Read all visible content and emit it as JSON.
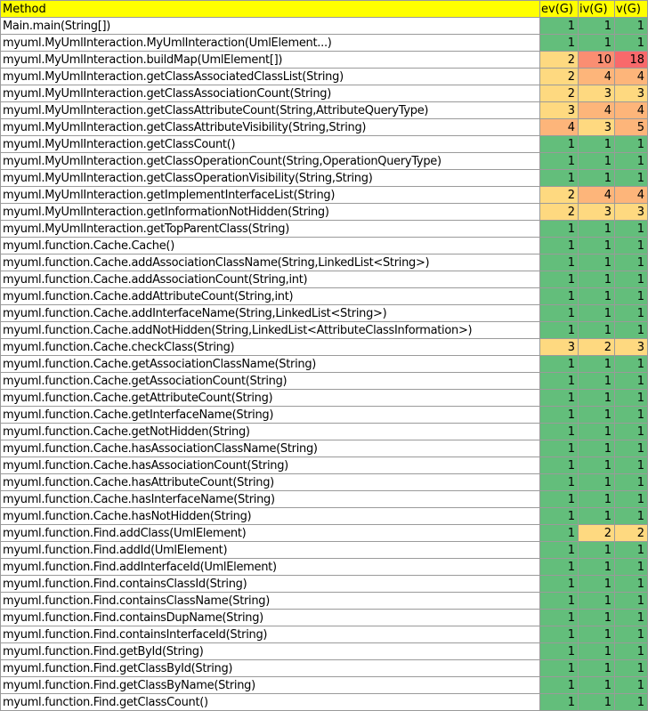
{
  "headers": [
    "Method",
    "ev(G)",
    "iv(G)",
    "v(G)"
  ],
  "colors": {
    "header": "#ffff00",
    "green": "#63be7b",
    "light_orange": "#fed980",
    "orange": "#fdb57a",
    "red": "#f8696b",
    "salmon": "#fa8e72",
    "grid": "#9a9a9a"
  },
  "rows": [
    {
      "method": "Main.main(String[])",
      "ev": "1",
      "iv": "1",
      "v": "1",
      "ev_color": "green",
      "iv_color": "green",
      "v_color": "green"
    },
    {
      "method": "myuml.MyUmlInteraction.MyUmlInteraction(UmlElement...)",
      "ev": "1",
      "iv": "1",
      "v": "1",
      "ev_color": "green",
      "iv_color": "green",
      "v_color": "green"
    },
    {
      "method": "myuml.MyUmlInteraction.buildMap(UmlElement[])",
      "ev": "2",
      "iv": "10",
      "v": "18",
      "ev_color": "light_orange",
      "iv_color": "salmon",
      "v_color": "red"
    },
    {
      "method": "myuml.MyUmlInteraction.getClassAssociatedClassList(String)",
      "ev": "2",
      "iv": "4",
      "v": "4",
      "ev_color": "light_orange",
      "iv_color": "orange",
      "v_color": "orange"
    },
    {
      "method": "myuml.MyUmlInteraction.getClassAssociationCount(String)",
      "ev": "2",
      "iv": "3",
      "v": "3",
      "ev_color": "light_orange",
      "iv_color": "light_orange",
      "v_color": "light_orange"
    },
    {
      "method": "myuml.MyUmlInteraction.getClassAttributeCount(String,AttributeQueryType)",
      "ev": "3",
      "iv": "4",
      "v": "4",
      "ev_color": "light_orange",
      "iv_color": "orange",
      "v_color": "orange"
    },
    {
      "method": "myuml.MyUmlInteraction.getClassAttributeVisibility(String,String)",
      "ev": "4",
      "iv": "3",
      "v": "5",
      "ev_color": "orange",
      "iv_color": "light_orange",
      "v_color": "orange"
    },
    {
      "method": "myuml.MyUmlInteraction.getClassCount()",
      "ev": "1",
      "iv": "1",
      "v": "1",
      "ev_color": "green",
      "iv_color": "green",
      "v_color": "green"
    },
    {
      "method": "myuml.MyUmlInteraction.getClassOperationCount(String,OperationQueryType)",
      "ev": "1",
      "iv": "1",
      "v": "1",
      "ev_color": "green",
      "iv_color": "green",
      "v_color": "green"
    },
    {
      "method": "myuml.MyUmlInteraction.getClassOperationVisibility(String,String)",
      "ev": "1",
      "iv": "1",
      "v": "1",
      "ev_color": "green",
      "iv_color": "green",
      "v_color": "green"
    },
    {
      "method": "myuml.MyUmlInteraction.getImplementInterfaceList(String)",
      "ev": "2",
      "iv": "4",
      "v": "4",
      "ev_color": "light_orange",
      "iv_color": "orange",
      "v_color": "orange"
    },
    {
      "method": "myuml.MyUmlInteraction.getInformationNotHidden(String)",
      "ev": "2",
      "iv": "3",
      "v": "3",
      "ev_color": "light_orange",
      "iv_color": "light_orange",
      "v_color": "light_orange"
    },
    {
      "method": "myuml.MyUmlInteraction.getTopParentClass(String)",
      "ev": "1",
      "iv": "1",
      "v": "1",
      "ev_color": "green",
      "iv_color": "green",
      "v_color": "green"
    },
    {
      "method": "myuml.function.Cache.Cache()",
      "ev": "1",
      "iv": "1",
      "v": "1",
      "ev_color": "green",
      "iv_color": "green",
      "v_color": "green"
    },
    {
      "method": "myuml.function.Cache.addAssociationClassName(String,LinkedList<String>)",
      "ev": "1",
      "iv": "1",
      "v": "1",
      "ev_color": "green",
      "iv_color": "green",
      "v_color": "green"
    },
    {
      "method": "myuml.function.Cache.addAssociationCount(String,int)",
      "ev": "1",
      "iv": "1",
      "v": "1",
      "ev_color": "green",
      "iv_color": "green",
      "v_color": "green"
    },
    {
      "method": "myuml.function.Cache.addAttributeCount(String,int)",
      "ev": "1",
      "iv": "1",
      "v": "1",
      "ev_color": "green",
      "iv_color": "green",
      "v_color": "green"
    },
    {
      "method": "myuml.function.Cache.addInterfaceName(String,LinkedList<String>)",
      "ev": "1",
      "iv": "1",
      "v": "1",
      "ev_color": "green",
      "iv_color": "green",
      "v_color": "green"
    },
    {
      "method": "myuml.function.Cache.addNotHidden(String,LinkedList<AttributeClassInformation>)",
      "ev": "1",
      "iv": "1",
      "v": "1",
      "ev_color": "green",
      "iv_color": "green",
      "v_color": "green"
    },
    {
      "method": "myuml.function.Cache.checkClass(String)",
      "ev": "3",
      "iv": "2",
      "v": "3",
      "ev_color": "light_orange",
      "iv_color": "light_orange",
      "v_color": "light_orange"
    },
    {
      "method": "myuml.function.Cache.getAssociationClassName(String)",
      "ev": "1",
      "iv": "1",
      "v": "1",
      "ev_color": "green",
      "iv_color": "green",
      "v_color": "green"
    },
    {
      "method": "myuml.function.Cache.getAssociationCount(String)",
      "ev": "1",
      "iv": "1",
      "v": "1",
      "ev_color": "green",
      "iv_color": "green",
      "v_color": "green"
    },
    {
      "method": "myuml.function.Cache.getAttributeCount(String)",
      "ev": "1",
      "iv": "1",
      "v": "1",
      "ev_color": "green",
      "iv_color": "green",
      "v_color": "green"
    },
    {
      "method": "myuml.function.Cache.getInterfaceName(String)",
      "ev": "1",
      "iv": "1",
      "v": "1",
      "ev_color": "green",
      "iv_color": "green",
      "v_color": "green"
    },
    {
      "method": "myuml.function.Cache.getNotHidden(String)",
      "ev": "1",
      "iv": "1",
      "v": "1",
      "ev_color": "green",
      "iv_color": "green",
      "v_color": "green"
    },
    {
      "method": "myuml.function.Cache.hasAssociationClassName(String)",
      "ev": "1",
      "iv": "1",
      "v": "1",
      "ev_color": "green",
      "iv_color": "green",
      "v_color": "green"
    },
    {
      "method": "myuml.function.Cache.hasAssociationCount(String)",
      "ev": "1",
      "iv": "1",
      "v": "1",
      "ev_color": "green",
      "iv_color": "green",
      "v_color": "green"
    },
    {
      "method": "myuml.function.Cache.hasAttributeCount(String)",
      "ev": "1",
      "iv": "1",
      "v": "1",
      "ev_color": "green",
      "iv_color": "green",
      "v_color": "green"
    },
    {
      "method": "myuml.function.Cache.hasInterfaceName(String)",
      "ev": "1",
      "iv": "1",
      "v": "1",
      "ev_color": "green",
      "iv_color": "green",
      "v_color": "green"
    },
    {
      "method": "myuml.function.Cache.hasNotHidden(String)",
      "ev": "1",
      "iv": "1",
      "v": "1",
      "ev_color": "green",
      "iv_color": "green",
      "v_color": "green"
    },
    {
      "method": "myuml.function.Find.addClass(UmlElement)",
      "ev": "1",
      "iv": "2",
      "v": "2",
      "ev_color": "green",
      "iv_color": "light_orange",
      "v_color": "light_orange"
    },
    {
      "method": "myuml.function.Find.addId(UmlElement)",
      "ev": "1",
      "iv": "1",
      "v": "1",
      "ev_color": "green",
      "iv_color": "green",
      "v_color": "green"
    },
    {
      "method": "myuml.function.Find.addInterfaceId(UmlElement)",
      "ev": "1",
      "iv": "1",
      "v": "1",
      "ev_color": "green",
      "iv_color": "green",
      "v_color": "green"
    },
    {
      "method": "myuml.function.Find.containsClassId(String)",
      "ev": "1",
      "iv": "1",
      "v": "1",
      "ev_color": "green",
      "iv_color": "green",
      "v_color": "green"
    },
    {
      "method": "myuml.function.Find.containsClassName(String)",
      "ev": "1",
      "iv": "1",
      "v": "1",
      "ev_color": "green",
      "iv_color": "green",
      "v_color": "green"
    },
    {
      "method": "myuml.function.Find.containsDupName(String)",
      "ev": "1",
      "iv": "1",
      "v": "1",
      "ev_color": "green",
      "iv_color": "green",
      "v_color": "green"
    },
    {
      "method": "myuml.function.Find.containsInterfaceId(String)",
      "ev": "1",
      "iv": "1",
      "v": "1",
      "ev_color": "green",
      "iv_color": "green",
      "v_color": "green"
    },
    {
      "method": "myuml.function.Find.getById(String)",
      "ev": "1",
      "iv": "1",
      "v": "1",
      "ev_color": "green",
      "iv_color": "green",
      "v_color": "green"
    },
    {
      "method": "myuml.function.Find.getClassById(String)",
      "ev": "1",
      "iv": "1",
      "v": "1",
      "ev_color": "green",
      "iv_color": "green",
      "v_color": "green"
    },
    {
      "method": "myuml.function.Find.getClassByName(String)",
      "ev": "1",
      "iv": "1",
      "v": "1",
      "ev_color": "green",
      "iv_color": "green",
      "v_color": "green"
    },
    {
      "method": "myuml.function.Find.getClassCount()",
      "ev": "1",
      "iv": "1",
      "v": "1",
      "ev_color": "green",
      "iv_color": "green",
      "v_color": "green"
    }
  ]
}
